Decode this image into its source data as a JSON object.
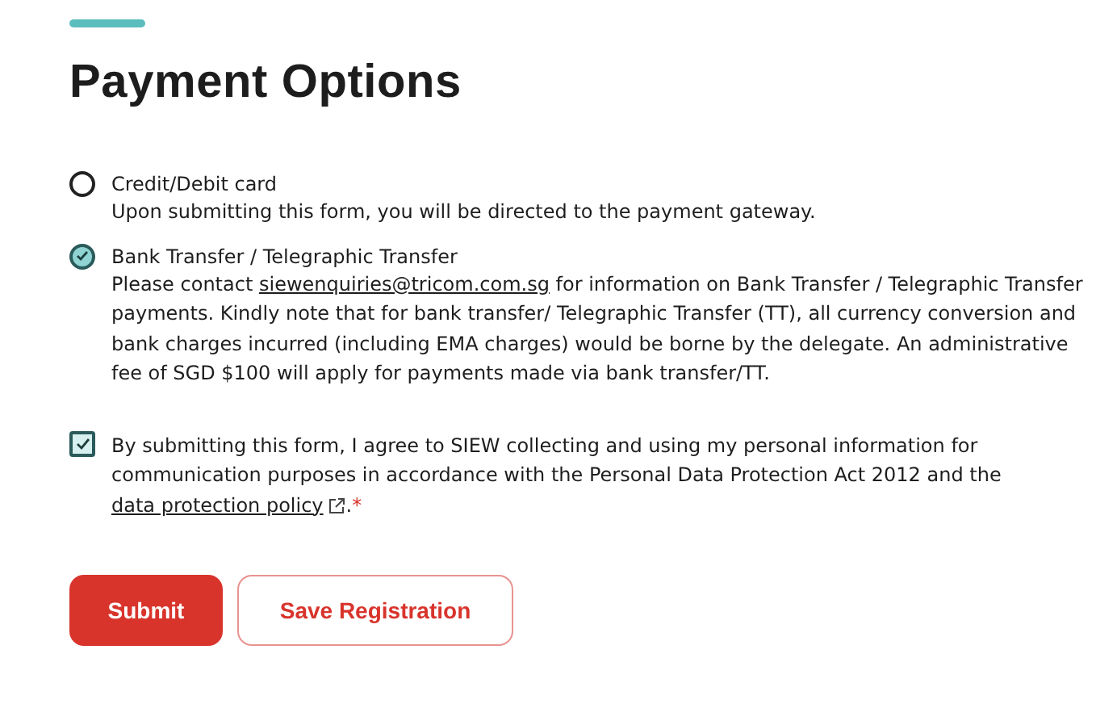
{
  "title": "Payment Options",
  "options": [
    {
      "label": "Credit/Debit card",
      "selected": false,
      "description": "Upon submitting this form, you will be directed to the payment gateway."
    },
    {
      "label": "Bank Transfer / Telegraphic Transfer",
      "selected": true,
      "description_before": "Please contact ",
      "link": "siewenquiries@tricom.com.sg",
      "description": "for information on Bank Transfer / Telegraphic Transfer payments. Kindly note that for bank transfer/ Telegraphic Transfer (TT), all currency conversion and bank charges incurred (including EMA charges) would be borne by the delegate. An administrative fee of SGD $100 will apply for payments made via bank transfer/TT."
    }
  ],
  "consent": {
    "checked": true,
    "text": "By submitting this form, I agree to SIEW collecting and using my personal information for communication purposes in accordance with the Personal Data Protection Act 2012 and the ",
    "link": "data protection policy",
    "after": ".",
    "required": "*"
  },
  "buttons": [
    {
      "label": "Submit",
      "kind": "primary"
    },
    {
      "label": "Save Registration",
      "kind": "secondary"
    }
  ]
}
